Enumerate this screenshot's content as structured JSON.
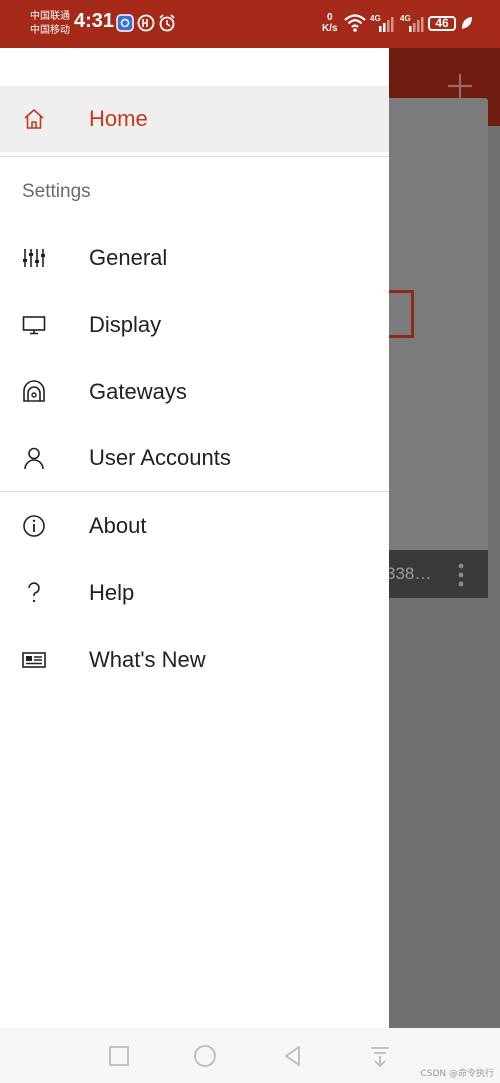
{
  "status_bar": {
    "carrier_1": "中国联通",
    "carrier_2": "中国移动",
    "time": "4:31",
    "net_speed_value": "0",
    "net_speed_unit": "K/s",
    "signal_1": "4G",
    "signal_2": "4G",
    "battery": "46"
  },
  "background_app": {
    "card_footer_text": "338…"
  },
  "drawer": {
    "home": {
      "label": "Home",
      "icon": "home-icon"
    },
    "settings_header": "Settings",
    "settings_items": [
      {
        "label": "General",
        "icon": "sliders-icon"
      },
      {
        "label": "Display",
        "icon": "monitor-icon"
      },
      {
        "label": "Gateways",
        "icon": "gateway-icon"
      },
      {
        "label": "User Accounts",
        "icon": "user-icon"
      }
    ],
    "info_items": [
      {
        "label": "About",
        "icon": "info-icon"
      },
      {
        "label": "Help",
        "icon": "question-icon"
      },
      {
        "label": "What's New",
        "icon": "news-icon"
      }
    ]
  },
  "watermark": "CSDN @命令执行",
  "colors": {
    "status_bar": "#a52a1a",
    "accent": "#c23b22",
    "scrim": "#707070"
  }
}
